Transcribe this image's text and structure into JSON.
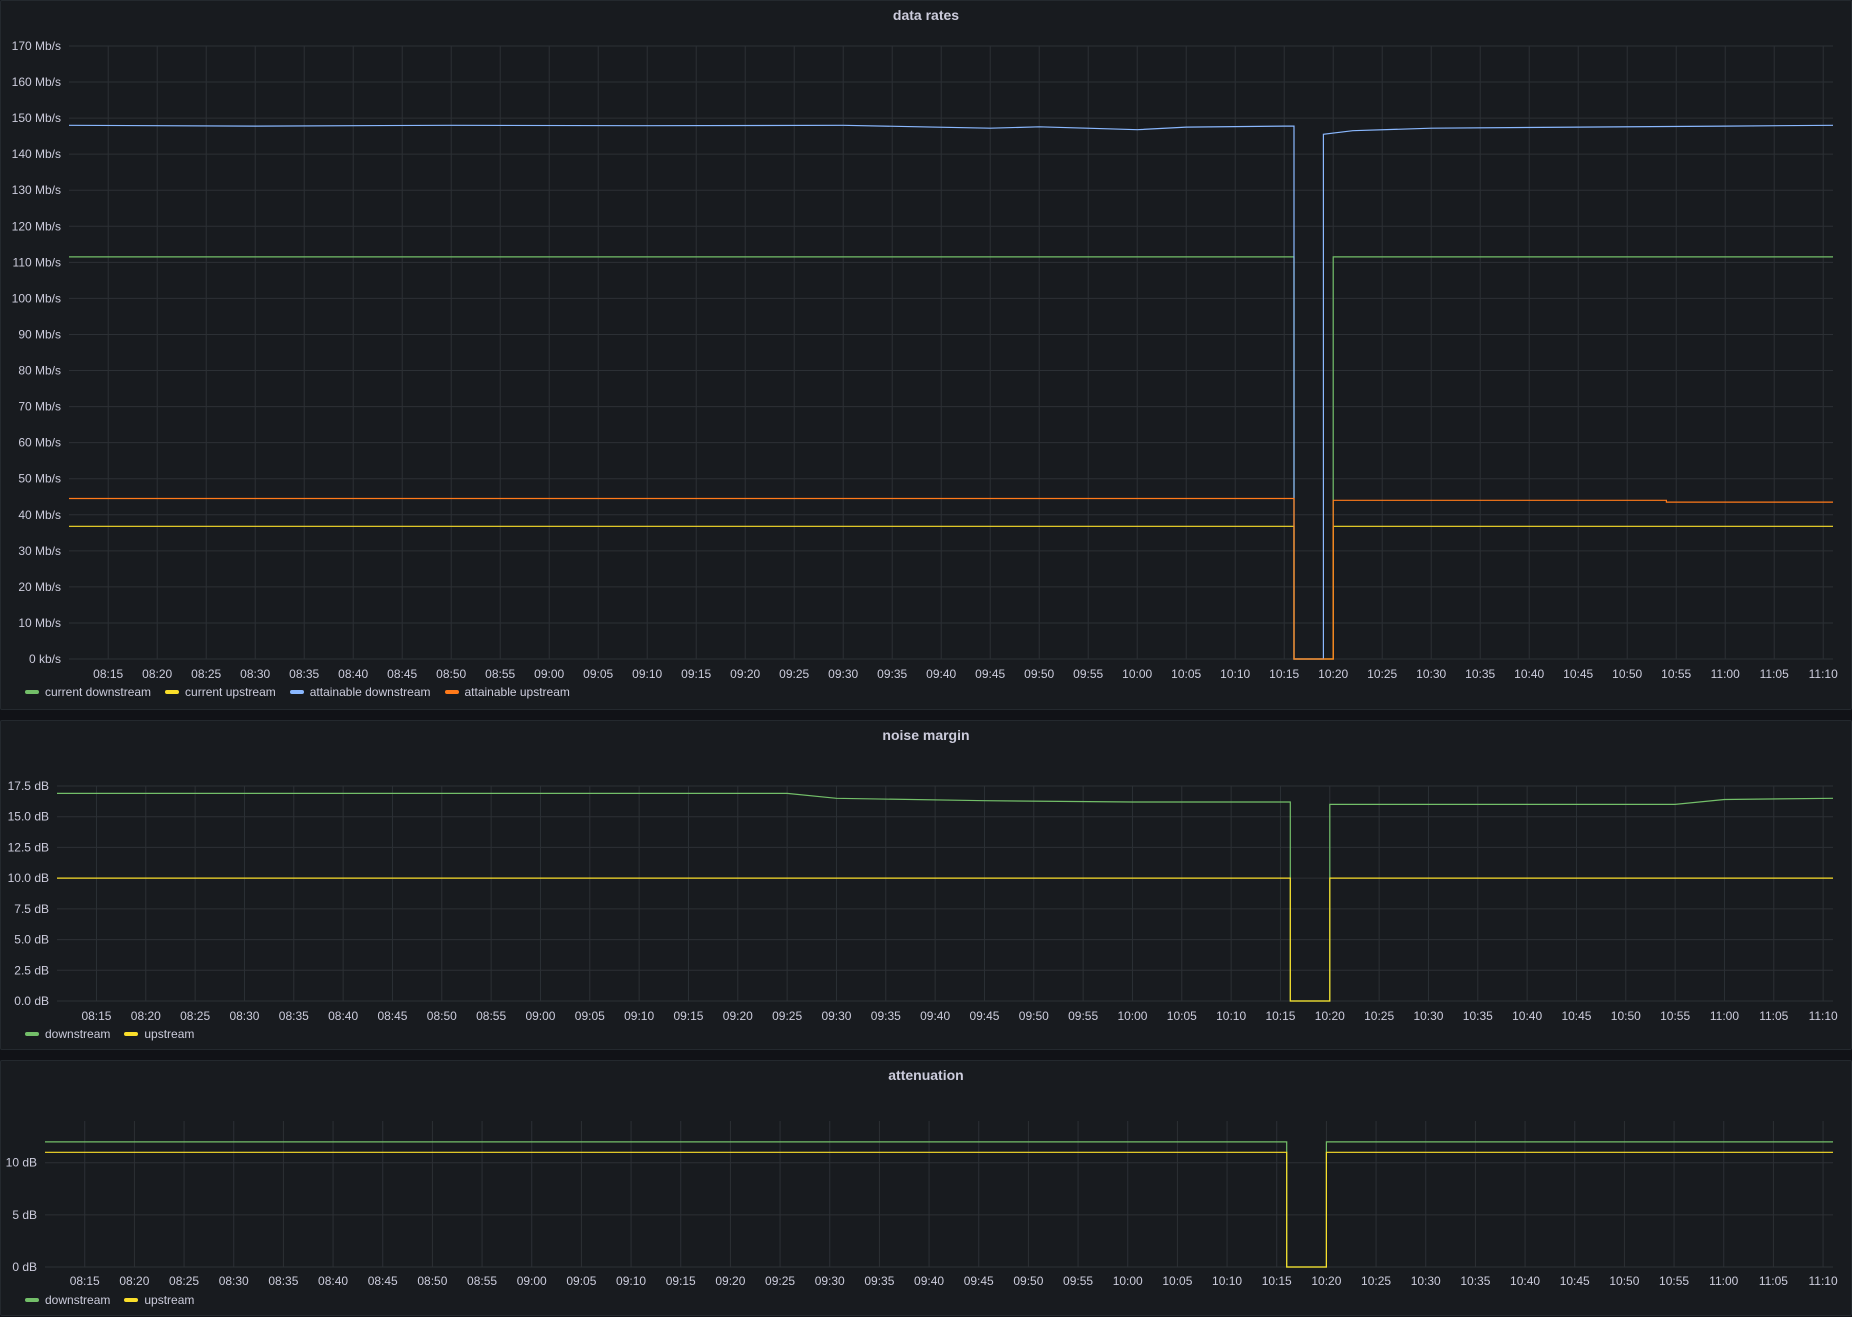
{
  "chart_data": [
    {
      "type": "line",
      "title": "data rates",
      "y_unit": "Mb/s",
      "ylim": [
        0,
        170
      ],
      "y_ticks": [
        {
          "v": 0,
          "label": "0 kb/s"
        },
        {
          "v": 10,
          "label": "10 Mb/s"
        },
        {
          "v": 20,
          "label": "20 Mb/s"
        },
        {
          "v": 30,
          "label": "30 Mb/s"
        },
        {
          "v": 40,
          "label": "40 Mb/s"
        },
        {
          "v": 50,
          "label": "50 Mb/s"
        },
        {
          "v": 60,
          "label": "60 Mb/s"
        },
        {
          "v": 70,
          "label": "70 Mb/s"
        },
        {
          "v": 80,
          "label": "80 Mb/s"
        },
        {
          "v": 90,
          "label": "90 Mb/s"
        },
        {
          "v": 100,
          "label": "100 Mb/s"
        },
        {
          "v": 110,
          "label": "110 Mb/s"
        },
        {
          "v": 120,
          "label": "120 Mb/s"
        },
        {
          "v": 130,
          "label": "130 Mb/s"
        },
        {
          "v": 140,
          "label": "140 Mb/s"
        },
        {
          "v": 150,
          "label": "150 Mb/s"
        },
        {
          "v": 160,
          "label": "160 Mb/s"
        },
        {
          "v": 170,
          "label": "170 Mb/s"
        }
      ],
      "x_ticks": [
        "08:15",
        "08:20",
        "08:25",
        "08:30",
        "08:35",
        "08:40",
        "08:45",
        "08:50",
        "08:55",
        "09:00",
        "09:05",
        "09:10",
        "09:15",
        "09:20",
        "09:25",
        "09:30",
        "09:35",
        "09:40",
        "09:45",
        "09:50",
        "09:55",
        "10:00",
        "10:05",
        "10:10",
        "10:15",
        "10:20",
        "10:25",
        "10:30",
        "10:35",
        "10:40",
        "10:45",
        "10:50",
        "10:55",
        "11:00",
        "11:05",
        "11:10"
      ],
      "x_range": [
        "08:11",
        "11:11"
      ],
      "grid": true,
      "legend_position": "bottom-left",
      "series": [
        {
          "name": "current downstream",
          "color": "#73bf69",
          "points": [
            [
              "08:11",
              111.5
            ],
            [
              "10:16",
              111.5
            ],
            [
              "10:16",
              0
            ],
            [
              "10:20",
              0
            ],
            [
              "10:20",
              111.5
            ],
            [
              "11:11",
              111.5
            ]
          ]
        },
        {
          "name": "current upstream",
          "color": "#fade2a",
          "points": [
            [
              "08:11",
              36.8
            ],
            [
              "10:16",
              36.8
            ],
            [
              "10:16",
              0
            ],
            [
              "10:20",
              0
            ],
            [
              "10:20",
              36.8
            ],
            [
              "11:11",
              36.8
            ]
          ]
        },
        {
          "name": "attainable downstream",
          "color": "#8ab8ff",
          "points": [
            [
              "08:11",
              148
            ],
            [
              "08:30",
              147.8
            ],
            [
              "08:50",
              148
            ],
            [
              "09:10",
              147.9
            ],
            [
              "09:30",
              148
            ],
            [
              "09:45",
              147.2
            ],
            [
              "09:50",
              147.6
            ],
            [
              "10:00",
              146.8
            ],
            [
              "10:05",
              147.5
            ],
            [
              "10:15",
              147.8
            ],
            [
              "10:16",
              147.8
            ],
            [
              "10:16",
              0
            ],
            [
              "10:19",
              0
            ],
            [
              "10:19",
              145.5
            ],
            [
              "10:22",
              146.5
            ],
            [
              "10:30",
              147.2
            ],
            [
              "10:45",
              147.5
            ],
            [
              "11:00",
              147.8
            ],
            [
              "11:11",
              148
            ]
          ]
        },
        {
          "name": "attainable upstream",
          "color": "#ff7a1a",
          "points": [
            [
              "08:11",
              44.5
            ],
            [
              "10:16",
              44.5
            ],
            [
              "10:16",
              0
            ],
            [
              "10:20",
              0
            ],
            [
              "10:20",
              44
            ],
            [
              "10:54",
              44
            ],
            [
              "10:54",
              43.5
            ],
            [
              "11:11",
              43.5
            ]
          ]
        }
      ]
    },
    {
      "type": "line",
      "title": "noise margin",
      "y_unit": "dB",
      "ylim": [
        0,
        17.5
      ],
      "y_ticks": [
        {
          "v": 0,
          "label": "0.0 dB"
        },
        {
          "v": 2.5,
          "label": "2.5 dB"
        },
        {
          "v": 5,
          "label": "5.0 dB"
        },
        {
          "v": 7.5,
          "label": "7.5 dB"
        },
        {
          "v": 10,
          "label": "10.0 dB"
        },
        {
          "v": 12.5,
          "label": "12.5 dB"
        },
        {
          "v": 15,
          "label": "15.0 dB"
        },
        {
          "v": 17.5,
          "label": "17.5 dB"
        }
      ],
      "x_ticks": [
        "08:15",
        "08:20",
        "08:25",
        "08:30",
        "08:35",
        "08:40",
        "08:45",
        "08:50",
        "08:55",
        "09:00",
        "09:05",
        "09:10",
        "09:15",
        "09:20",
        "09:25",
        "09:30",
        "09:35",
        "09:40",
        "09:45",
        "09:50",
        "09:55",
        "10:00",
        "10:05",
        "10:10",
        "10:15",
        "10:20",
        "10:25",
        "10:30",
        "10:35",
        "10:40",
        "10:45",
        "10:50",
        "10:55",
        "11:00",
        "11:05",
        "11:10"
      ],
      "x_range": [
        "08:11",
        "11:11"
      ],
      "grid": true,
      "legend_position": "bottom-left",
      "series": [
        {
          "name": "downstream",
          "color": "#73bf69",
          "points": [
            [
              "08:11",
              16.9
            ],
            [
              "09:25",
              16.9
            ],
            [
              "09:30",
              16.5
            ],
            [
              "09:45",
              16.3
            ],
            [
              "10:00",
              16.2
            ],
            [
              "10:10",
              16.2
            ],
            [
              "10:16",
              16.2
            ],
            [
              "10:16",
              0
            ],
            [
              "10:20",
              0
            ],
            [
              "10:20",
              16
            ],
            [
              "10:55",
              16
            ],
            [
              "11:00",
              16.4
            ],
            [
              "11:11",
              16.5
            ]
          ]
        },
        {
          "name": "upstream",
          "color": "#fade2a",
          "points": [
            [
              "08:11",
              10
            ],
            [
              "10:16",
              10
            ],
            [
              "10:16",
              0
            ],
            [
              "10:20",
              0
            ],
            [
              "10:20",
              10
            ],
            [
              "11:11",
              10
            ]
          ]
        }
      ]
    },
    {
      "type": "line",
      "title": "attenuation",
      "y_unit": "dB",
      "ylim": [
        0,
        14
      ],
      "y_ticks": [
        {
          "v": 0,
          "label": "0 dB"
        },
        {
          "v": 5,
          "label": "5 dB"
        },
        {
          "v": 10,
          "label": "10 dB"
        }
      ],
      "x_ticks": [
        "08:15",
        "08:20",
        "08:25",
        "08:30",
        "08:35",
        "08:40",
        "08:45",
        "08:50",
        "08:55",
        "09:00",
        "09:05",
        "09:10",
        "09:15",
        "09:20",
        "09:25",
        "09:30",
        "09:35",
        "09:40",
        "09:45",
        "09:50",
        "09:55",
        "10:00",
        "10:05",
        "10:10",
        "10:15",
        "10:20",
        "10:25",
        "10:30",
        "10:35",
        "10:40",
        "10:45",
        "10:50",
        "10:55",
        "11:00",
        "11:05",
        "11:10"
      ],
      "x_range": [
        "08:11",
        "11:11"
      ],
      "grid": true,
      "legend_position": "bottom-left",
      "series": [
        {
          "name": "downstream",
          "color": "#73bf69",
          "points": [
            [
              "08:11",
              12
            ],
            [
              "10:16",
              12
            ],
            [
              "10:16",
              0
            ],
            [
              "10:20",
              0
            ],
            [
              "10:20",
              12
            ],
            [
              "11:11",
              12
            ]
          ]
        },
        {
          "name": "upstream",
          "color": "#fade2a",
          "points": [
            [
              "08:11",
              11
            ],
            [
              "10:16",
              11
            ],
            [
              "10:16",
              0
            ],
            [
              "10:20",
              0
            ],
            [
              "10:20",
              11
            ],
            [
              "11:11",
              11
            ]
          ]
        }
      ]
    }
  ]
}
